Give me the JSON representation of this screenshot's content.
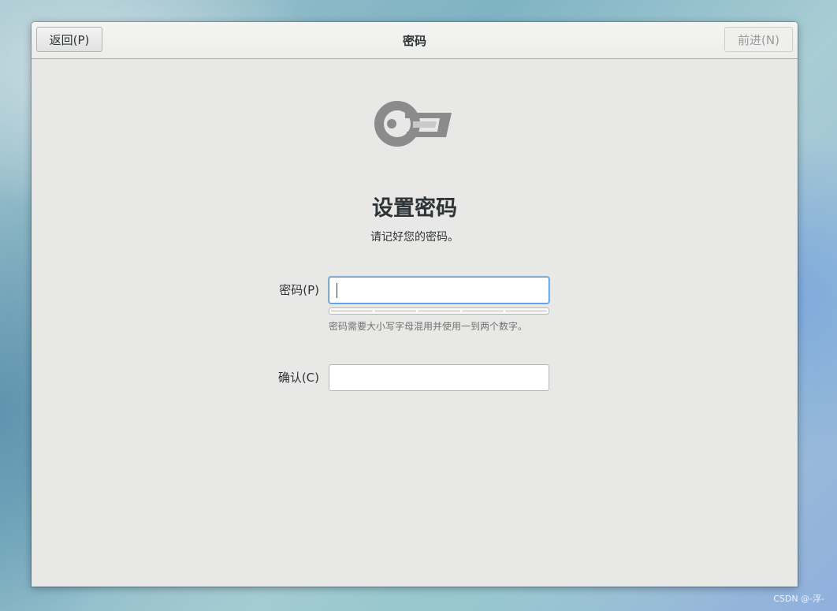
{
  "header": {
    "back_label": "返回(P)",
    "title": "密码",
    "next_label": "前进(N)"
  },
  "main": {
    "icon": "key-icon",
    "heading": "设置密码",
    "subheading": "请记好您的密码。",
    "password_label": "密码(P)",
    "password_value": "",
    "strength": {
      "segments": 5,
      "filled": 0
    },
    "password_hint": "密码需要大小写字母混用并使用一到两个数字。",
    "confirm_label": "确认(C)",
    "confirm_value": ""
  },
  "watermark": "CSDN @-浮-"
}
